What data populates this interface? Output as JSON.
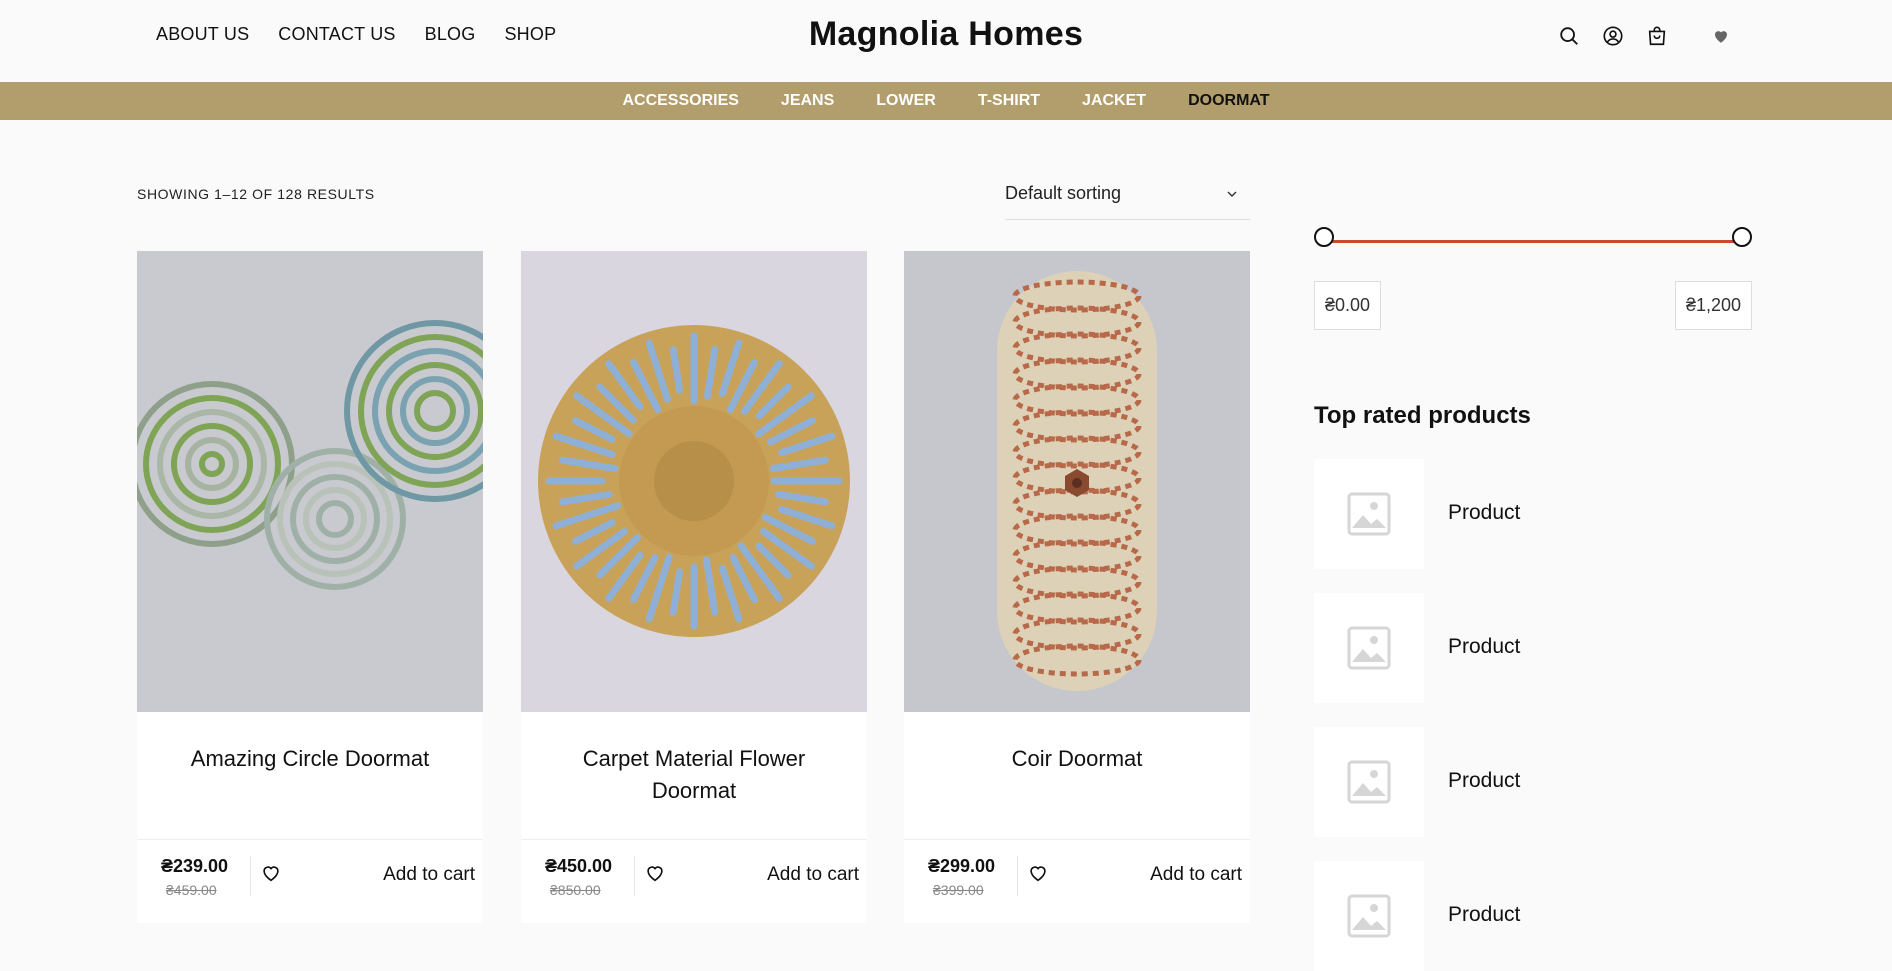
{
  "header": {
    "nav": [
      "ABOUT US",
      "CONTACT US",
      "BLOG",
      "SHOP"
    ],
    "brand": "Magnolia Homes",
    "icons": [
      "search-icon",
      "account-icon",
      "cart-icon",
      "wishlist-heart-icon"
    ]
  },
  "categories": {
    "items": [
      "ACCESSORIES",
      "JEANS",
      "LOWER",
      "T-SHIRT",
      "JACKET",
      "DOORMAT"
    ],
    "active": "DOORMAT"
  },
  "results": {
    "count_text": "SHOWING 1–12 OF 128 RESULTS",
    "sorting": "Default sorting"
  },
  "products": [
    {
      "title": "Amazing Circle Doormat",
      "price": "₴239.00",
      "old_price": "₴459.00",
      "cart": "Add to cart"
    },
    {
      "title": "Carpet Material Flower Doormat",
      "price": "₴450.00",
      "old_price": "₴850.00",
      "cart": "Add to cart"
    },
    {
      "title": "Coir Doormat",
      "price": "₴299.00",
      "old_price": "₴399.00",
      "cart": "Add to cart"
    }
  ],
  "sidebar": {
    "price_min": "₴0.00",
    "price_max": "₴1,200",
    "top_rated_title": "Top rated products",
    "top_rated": [
      "Product",
      "Product",
      "Product",
      "Product"
    ]
  },
  "colors": {
    "category_bar": "#b29d6c",
    "slider_track": "#c94a2c"
  }
}
